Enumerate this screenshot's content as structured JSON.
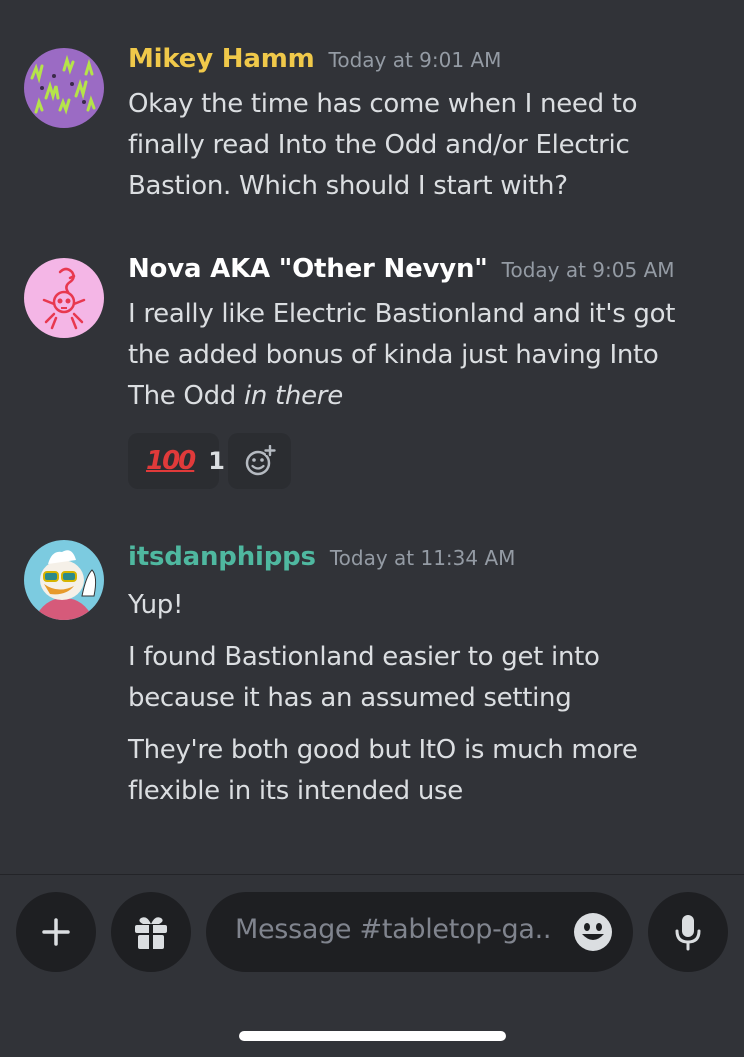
{
  "messages": [
    {
      "author": "Mikey Hamm",
      "author_color": "#f0c94a",
      "timestamp": "Today at 9:01 AM",
      "lines": [
        "Okay the time has come when I need to",
        "finally read Into the Odd and/or Electric",
        "Bastion. Which should I start with?"
      ]
    },
    {
      "author": "Nova AKA \"Other Nevyn\"",
      "author_color": "#ffffff",
      "timestamp": "Today at 9:05 AM",
      "lines": [
        "I really like Electric Bastionland and it's got",
        "the added bonus of kinda just having Into"
      ],
      "last_line_plain": "The Odd ",
      "last_line_italic": "in there",
      "reactions": [
        {
          "emoji": "100",
          "count": "1"
        }
      ]
    },
    {
      "author": "itsdanphipps",
      "author_color": "#4fb8a0",
      "timestamp": "Today at 11:34 AM",
      "paragraphs": [
        [
          "Yup!"
        ],
        [
          "I found Bastionland easier to get into",
          "because it has an assumed setting"
        ],
        [
          "They're both good but ItO is much more",
          "flexible in its intended use"
        ]
      ]
    }
  ],
  "composer": {
    "placeholder": "Message #tabletop-ga.."
  },
  "icons": {
    "plus": "plus-icon",
    "gift": "gift-icon",
    "emoji": "smiley-icon",
    "mic": "microphone-icon",
    "add_reaction": "add-reaction-icon"
  }
}
